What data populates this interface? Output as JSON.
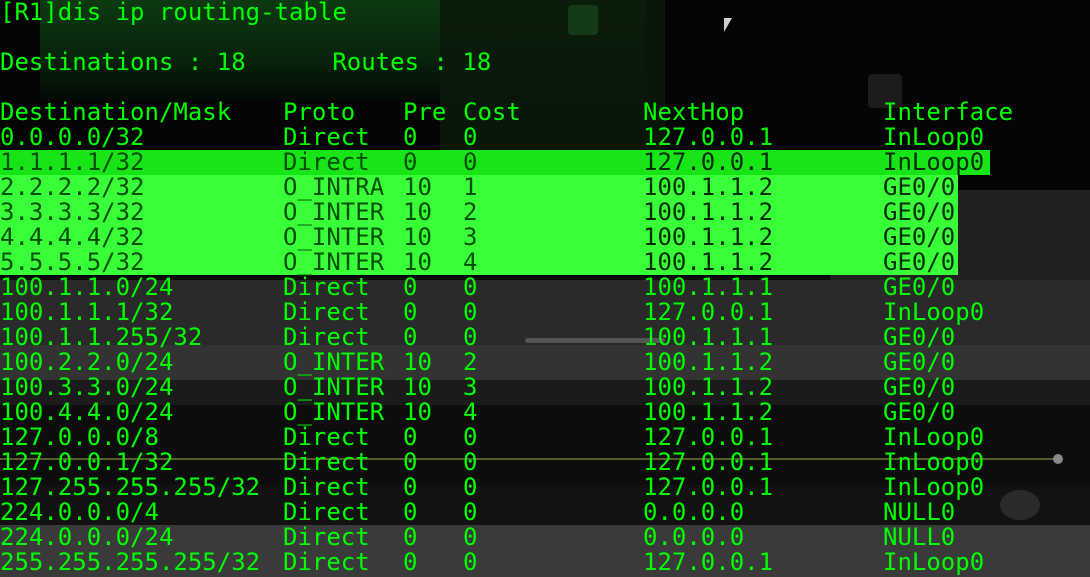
{
  "terminal": {
    "command_line": "[R1]dis ip routing-table",
    "summary": {
      "destinations_label": "Destinations",
      "destinations_value": "18",
      "routes_label": "Routes",
      "routes_value": "18",
      "text": "Destinations : 18      Routes : 18"
    },
    "headers": {
      "destination": "Destination/Mask",
      "proto": "Proto",
      "pre": "Pre",
      "cost": "Cost",
      "nexthop": "NextHop",
      "interface": "Interface"
    },
    "routes": [
      {
        "dest": "0.0.0.0/32",
        "proto": "Direct",
        "pre": "0",
        "cost": "0",
        "nexthop": "127.0.0.1",
        "iface": "InLoop0"
      },
      {
        "dest": "1.1.1.1/32",
        "proto": "Direct",
        "pre": "0",
        "cost": "0",
        "nexthop": "127.0.0.1",
        "iface": "InLoop0"
      },
      {
        "dest": "2.2.2.2/32",
        "proto": "O_INTRA",
        "pre": "10",
        "cost": "1",
        "nexthop": "100.1.1.2",
        "iface": "GE0/0"
      },
      {
        "dest": "3.3.3.3/32",
        "proto": "O_INTER",
        "pre": "10",
        "cost": "2",
        "nexthop": "100.1.1.2",
        "iface": "GE0/0"
      },
      {
        "dest": "4.4.4.4/32",
        "proto": "O_INTER",
        "pre": "10",
        "cost": "3",
        "nexthop": "100.1.1.2",
        "iface": "GE0/0"
      },
      {
        "dest": "5.5.5.5/32",
        "proto": "O_INTER",
        "pre": "10",
        "cost": "4",
        "nexthop": "100.1.1.2",
        "iface": "GE0/0"
      },
      {
        "dest": "100.1.1.0/24",
        "proto": "Direct",
        "pre": "0",
        "cost": "0",
        "nexthop": "100.1.1.1",
        "iface": "GE0/0"
      },
      {
        "dest": "100.1.1.1/32",
        "proto": "Direct",
        "pre": "0",
        "cost": "0",
        "nexthop": "127.0.0.1",
        "iface": "InLoop0"
      },
      {
        "dest": "100.1.1.255/32",
        "proto": "Direct",
        "pre": "0",
        "cost": "0",
        "nexthop": "100.1.1.1",
        "iface": "GE0/0"
      },
      {
        "dest": "100.2.2.0/24",
        "proto": "O_INTER",
        "pre": "10",
        "cost": "2",
        "nexthop": "100.1.1.2",
        "iface": "GE0/0"
      },
      {
        "dest": "100.3.3.0/24",
        "proto": "O_INTER",
        "pre": "10",
        "cost": "3",
        "nexthop": "100.1.1.2",
        "iface": "GE0/0"
      },
      {
        "dest": "100.4.4.0/24",
        "proto": "O_INTER",
        "pre": "10",
        "cost": "4",
        "nexthop": "100.1.1.2",
        "iface": "GE0/0"
      },
      {
        "dest": "127.0.0.0/8",
        "proto": "Direct",
        "pre": "0",
        "cost": "0",
        "nexthop": "127.0.0.1",
        "iface": "InLoop0"
      },
      {
        "dest": "127.0.0.1/32",
        "proto": "Direct",
        "pre": "0",
        "cost": "0",
        "nexthop": "127.0.0.1",
        "iface": "InLoop0"
      },
      {
        "dest": "127.255.255.255/32",
        "proto": "Direct",
        "pre": "0",
        "cost": "0",
        "nexthop": "127.0.0.1",
        "iface": "InLoop0"
      },
      {
        "dest": "224.0.0.0/4",
        "proto": "Direct",
        "pre": "0",
        "cost": "0",
        "nexthop": "0.0.0.0",
        "iface": "NULL0"
      },
      {
        "dest": "224.0.0.0/24",
        "proto": "Direct",
        "pre": "0",
        "cost": "0",
        "nexthop": "0.0.0.0",
        "iface": "NULL0"
      },
      {
        "dest": "255.255.255.255/32",
        "proto": "Direct",
        "pre": "0",
        "cost": "0",
        "nexthop": "127.0.0.1",
        "iface": "InLoop0"
      }
    ]
  },
  "colors": {
    "text": "#00ff00",
    "highlight_selected": "#18e518",
    "highlight_block": "#38ff38",
    "background": "#050505"
  }
}
